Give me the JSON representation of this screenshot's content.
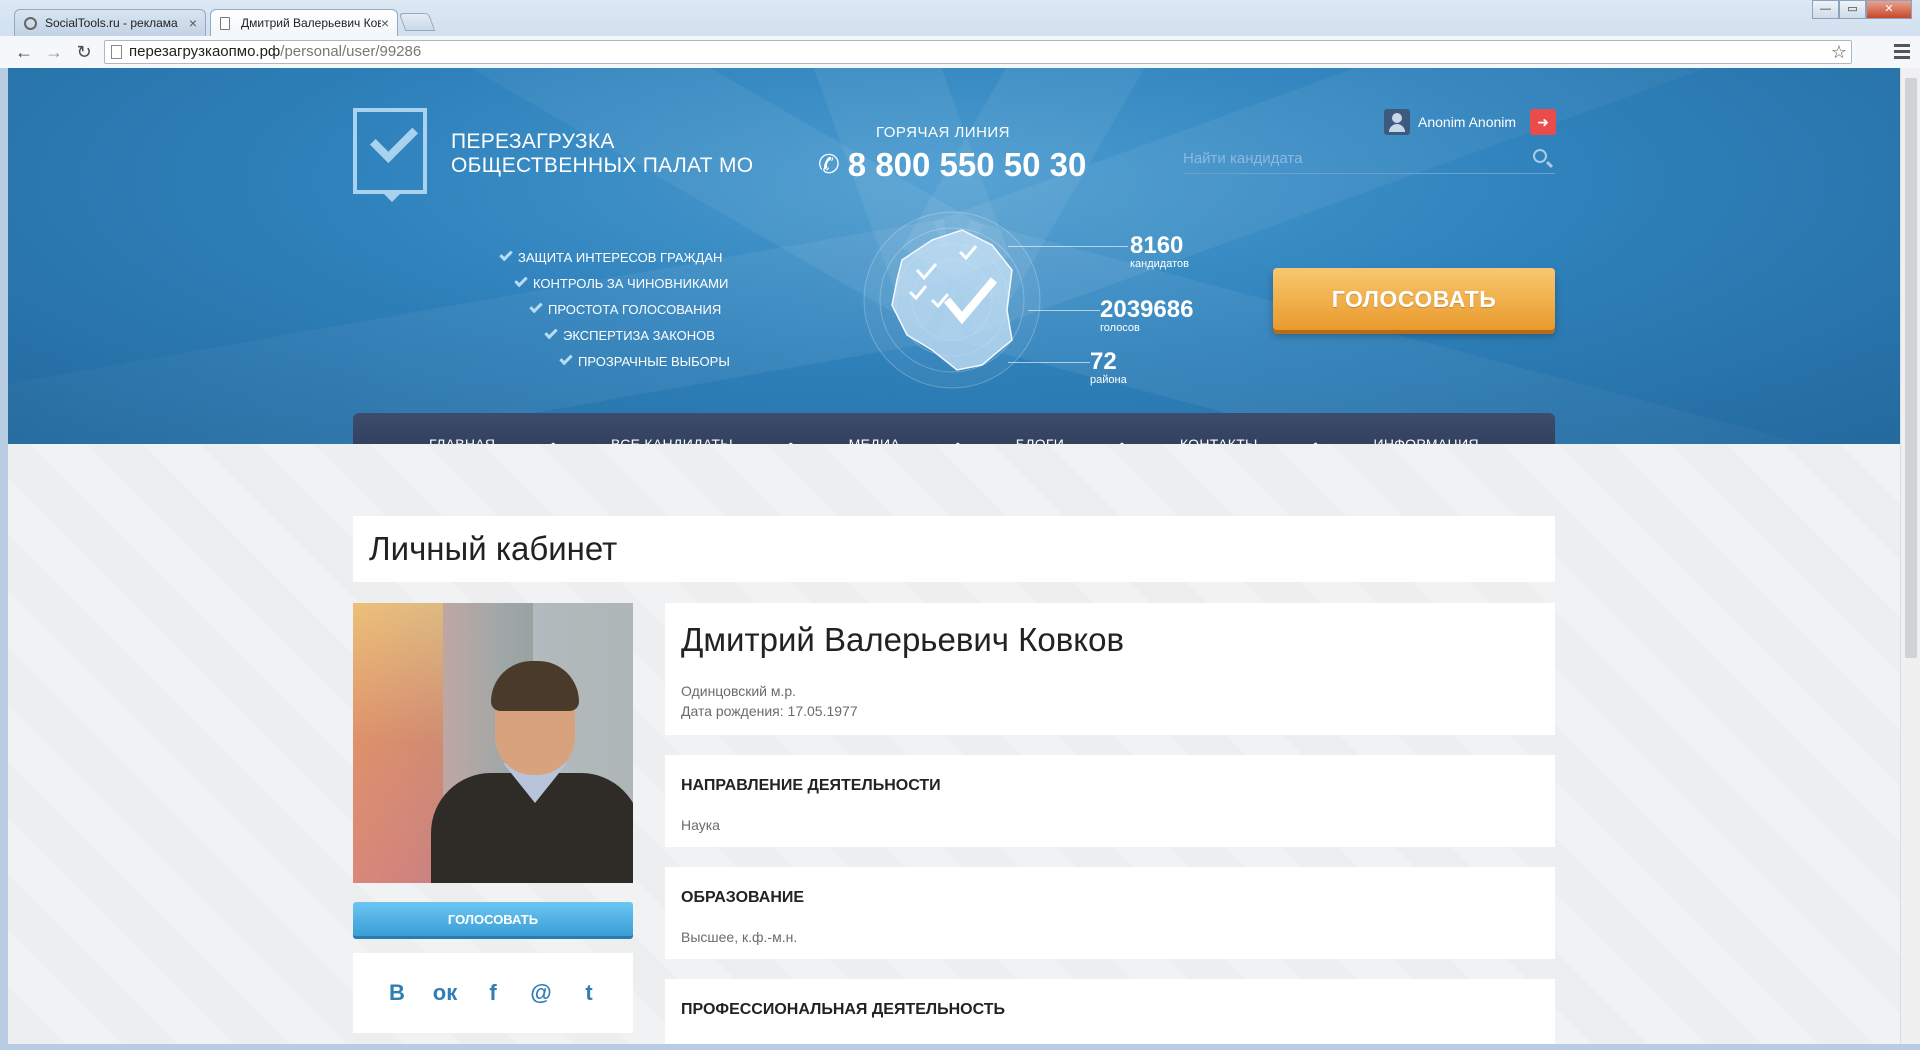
{
  "browser": {
    "tabs": [
      {
        "title": "SocialTools.ru - реклама"
      },
      {
        "title": "Дмитрий Валерьевич Ков"
      }
    ],
    "tab_close": "×",
    "url_domain": "перезагрузкаопмо.рф",
    "url_path": "/personal/user/99286",
    "back_icon": "←",
    "forward_icon": "→",
    "reload_icon": "↻",
    "star_icon": "☆",
    "window_buttons": {
      "minimize": "—",
      "maximize": "▭",
      "close": "✕"
    }
  },
  "header": {
    "title_line1": "ПЕРЕЗАГРУЗКА",
    "title_line2": "ОБЩЕСТВЕННЫХ ПАЛАТ МО",
    "hotline_label": "ГОРЯЧАЯ ЛИНИЯ",
    "phone_icon": "✆",
    "phone": "8 800 550 50 30",
    "user_name": "Anonim Anonim",
    "logout_icon": "➜",
    "search_placeholder": "Найти кандидата",
    "features": [
      "ЗАЩИТА ИНТЕРЕСОВ ГРАЖДАН",
      "КОНТРОЛЬ ЗА ЧИНОВНИКАМИ",
      "ПРОСТОТА ГОЛОСОВАНИЯ",
      "ЭКСПЕРТИЗА ЗАКОНОВ",
      "ПРОЗРАЧНЫЕ ВЫБОРЫ"
    ],
    "stats": [
      {
        "value": "8160",
        "label": "кандидатов"
      },
      {
        "value": "2039686",
        "label": "голосов"
      },
      {
        "value": "72",
        "label": "района"
      }
    ],
    "vote_button": "ГОЛОСОВАТЬ"
  },
  "nav": {
    "items": [
      "ГЛАВНАЯ",
      "ВСЕ КАНДИДАТЫ",
      "МЕДИА",
      "БЛОГИ",
      "КОНТАКТЫ",
      "ИНФОРМАЦИЯ"
    ],
    "separator": "•"
  },
  "main": {
    "page_title": "Личный кабинет",
    "vote_button": "ГОЛОСОВАТЬ",
    "social": [
      "B",
      "ок",
      "f",
      "@",
      "t"
    ],
    "profile": {
      "name": "Дмитрий Валерьевич Ковков",
      "district": "Одинцовский м.р.",
      "birth": "Дата рождения: 17.05.1977"
    },
    "sections": [
      {
        "title": "НАПРАВЛЕНИЕ ДЕЯТЕЛЬНОСТИ",
        "body": "Наука"
      },
      {
        "title": "ОБРАЗОВАНИЕ",
        "body": "Высшее, к.ф.-м.н."
      },
      {
        "title": "ПРОФЕССИОНАЛЬНАЯ ДЕЯТЕЛЬНОСТЬ",
        "body": ""
      }
    ]
  },
  "colors": {
    "hero_blue": "#2f82bc",
    "nav_dark": "#283550",
    "vote_orange": "#e99a2c",
    "vote_blue": "#3a9ed6",
    "social_blue": "#2f7fb6"
  }
}
